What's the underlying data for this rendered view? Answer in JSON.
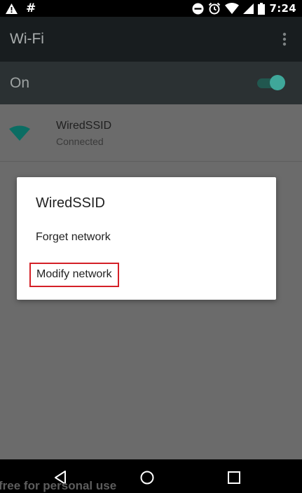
{
  "status_bar": {
    "time": "7:24",
    "left_icons": [
      "warning-icon",
      "hash-icon"
    ],
    "hash_glyph": "#",
    "right_icons": [
      "do-not-disturb-icon",
      "alarm-icon",
      "wifi-signal-icon",
      "cell-signal-icon",
      "battery-icon"
    ]
  },
  "app_bar": {
    "title": "Wi-Fi",
    "overflow_icon": "more-vert-icon"
  },
  "master_switch": {
    "label": "On",
    "state": "on",
    "accent_color": "#3fa79a"
  },
  "networks": [
    {
      "name": "WiredSSID",
      "status": "Connected",
      "icon": "wifi-full-icon",
      "icon_color": "#0b6d63"
    }
  ],
  "dialog": {
    "title": "WiredSSID",
    "items": [
      {
        "label": "Forget network"
      },
      {
        "label": "Modify network",
        "highlighted": true
      }
    ],
    "highlight_color": "#d42027"
  },
  "nav_bar": {
    "buttons": [
      "back-icon",
      "home-icon",
      "recents-icon"
    ]
  },
  "watermark": "free for personal use"
}
